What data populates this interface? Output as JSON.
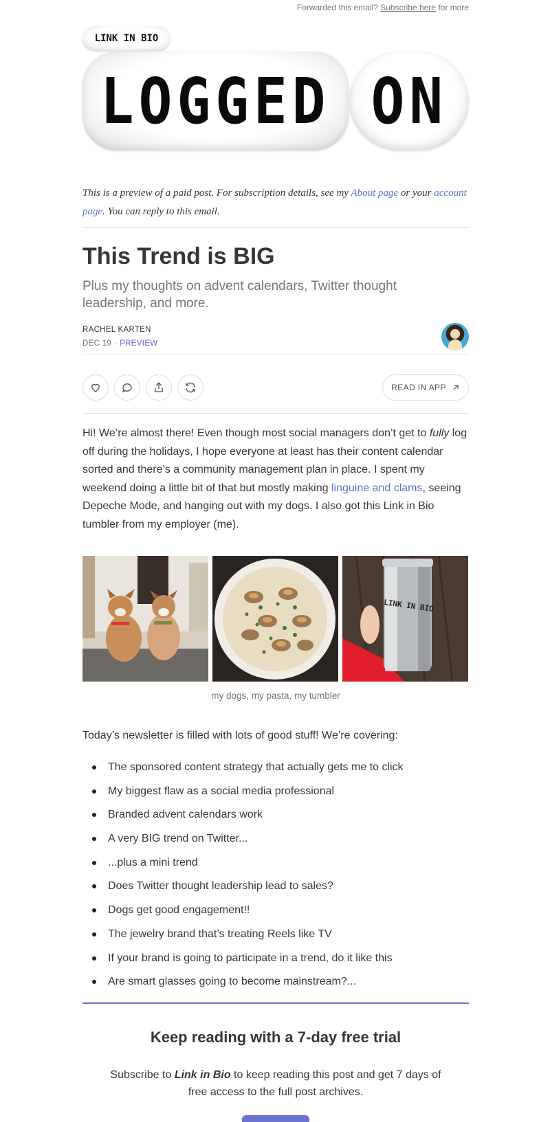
{
  "forward": {
    "prefix": "Forwarded this email?",
    "link": "Subscribe here",
    "suffix": "for more"
  },
  "header": {
    "badge": "LINK IN BIO",
    "word1": "LOGGED",
    "word2": "ON"
  },
  "preview_note": {
    "part1": "This is a preview of a paid post. For subscription details, see my",
    "about_link": "About page",
    "part2": "or your",
    "account_link": "account page",
    "part3": ". You can reply to this email."
  },
  "post": {
    "title": "This Trend is BIG",
    "subtitle": "Plus my thoughts on advent calendars, Twitter thought leadership, and more.",
    "author": "RACHEL KARTEN",
    "date": "DEC 19",
    "separator": "·",
    "tag": "PREVIEW"
  },
  "actions": {
    "like_icon": "heart-icon",
    "comment_icon": "comment-icon",
    "share_icon": "share-icon",
    "restack_icon": "restack-icon",
    "read_in_app": "READ IN APP",
    "read_icon": "arrow-up-right-icon"
  },
  "intro": {
    "p1": "Hi! We’re almost there! Even though most social managers don’t get to ",
    "fully": "fully",
    "p2": " log off during the holidays, I hope everyone at least has their content calendar sorted and there’s a community management plan in place. I spent my weekend doing a little bit of that but mostly making ",
    "link": "linguine and clams",
    "p3": ", seeing Depeche Mode, and hanging out with my dogs. I also got this Link in Bio tumbler from my employer (me)."
  },
  "photos": {
    "caption": "my dogs, my pasta, my tumbler",
    "tumbler_text": "LINK IN BIO"
  },
  "covering": {
    "intro": "Today’s newsletter is filled with lots of good stuff! We’re covering:",
    "items": [
      "The sponsored content strategy that actually gets me to click",
      "My biggest flaw as a social media professional",
      "Branded advent calendars work",
      "A very BIG trend on Twitter...",
      "...plus a mini trend",
      "Does Twitter thought leadership lead to sales?",
      "Dogs get good engagement!!",
      "The jewelry brand that’s treating Reels like TV",
      "If your brand is going to participate in a trend, do it like this",
      "Are smart glasses going to become mainstream?..."
    ]
  },
  "cta": {
    "title": "Keep reading with a 7-day free trial",
    "text1": "Subscribe to ",
    "brand": "Link in Bio",
    "text2": " to keep reading this post and get 7 days of free access to the full post archives."
  },
  "colors": {
    "accent": "#6b72cf",
    "link": "#5b73c7",
    "preview_tag": "#6b5fe4"
  }
}
